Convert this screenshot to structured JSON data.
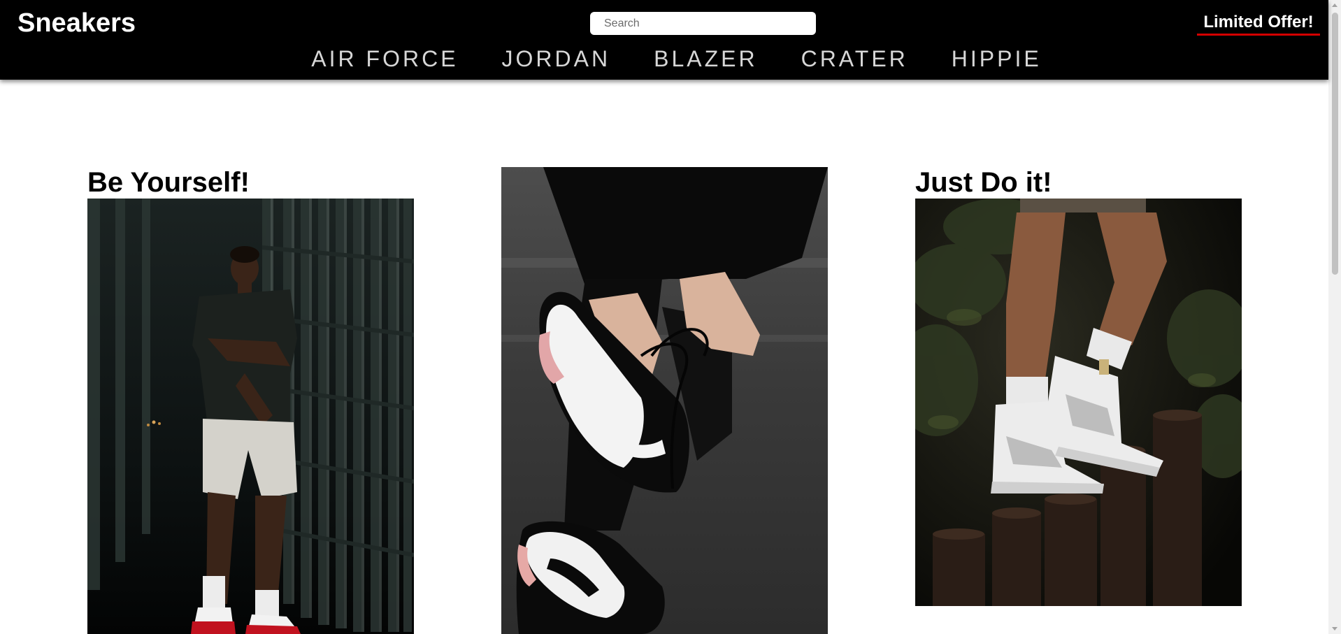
{
  "header": {
    "logo": "Sneakers",
    "search_placeholder": "Search",
    "offer_label": "Limited Offer!",
    "colors": {
      "background": "#000000",
      "offer_underline": "#d40000"
    }
  },
  "nav": {
    "items": [
      {
        "label": "AIR FORCE"
      },
      {
        "label": "JORDAN"
      },
      {
        "label": "BLAZER"
      },
      {
        "label": "CRATER"
      },
      {
        "label": "HIPPIE"
      }
    ]
  },
  "cards": [
    {
      "title": "Be Yourself!",
      "image_icon": "photo-man-in-sneakers-by-building"
    },
    {
      "title": "",
      "image_icon": "photo-hands-lacing-black-white-sneaker"
    },
    {
      "title": "Just Do it!",
      "image_icon": "photo-white-high-top-sneakers-on-stumps"
    }
  ]
}
